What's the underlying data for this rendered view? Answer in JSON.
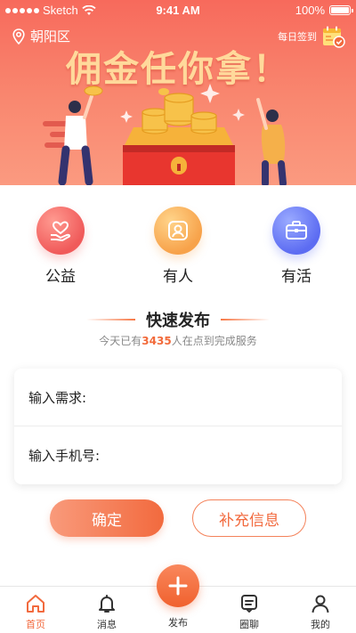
{
  "status_bar": {
    "carrier": "Sketch",
    "time": "9:41 AM",
    "battery": "100%"
  },
  "header": {
    "location": "朝阳区",
    "checkin_label": "每日签到",
    "banner_title": "佣金任你拿！"
  },
  "features": [
    {
      "label": "公益",
      "icon": "heart-hand-icon"
    },
    {
      "label": "有人",
      "icon": "person-portrait-icon"
    },
    {
      "label": "有活",
      "icon": "briefcase-icon"
    }
  ],
  "quick_publish": {
    "title": "快速发布",
    "subtitle_prefix": "今天已有",
    "count": "3435",
    "subtitle_suffix": "人在点到完成服务"
  },
  "form": {
    "need_label": "输入需求:",
    "phone_label": "输入手机号:"
  },
  "buttons": {
    "confirm": "确定",
    "more_info": "补充信息"
  },
  "tabbar": {
    "home": "首页",
    "messages": "消息",
    "publish": "发布",
    "circle": "圈聊",
    "mine": "我的"
  },
  "colors": {
    "accent": "#f26a3e",
    "hero_top": "#f76a5c",
    "title_gold": "#ffd99b"
  }
}
